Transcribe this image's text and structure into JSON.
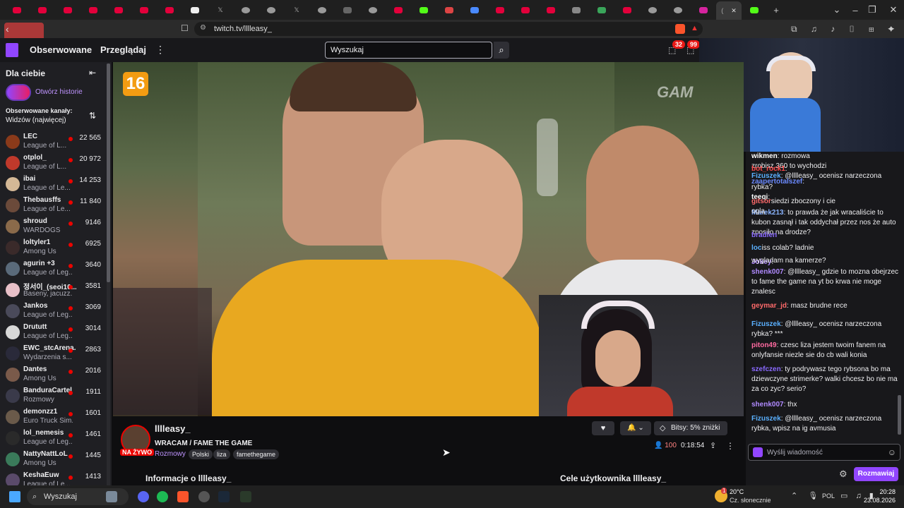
{
  "browser": {
    "url": "twitch.tv/lllleasy_",
    "tab_active_label": "(",
    "badge_extension": "99"
  },
  "topnav": {
    "following": "Obserwowane",
    "browse": "Przeglądaj",
    "search_placeholder": "Wyszukaj",
    "notif_count": "32",
    "inbox_count": "99"
  },
  "sidebar": {
    "title": "Dla ciebie",
    "stories": "Otwórz historie",
    "followed_label": "Obserwowane kanały:",
    "sort_label": "Widzów (najwięcej)",
    "channels": [
      {
        "name": "LEC",
        "game": "League of L...",
        "viewers": "22 565",
        "color": "#8a3a1a"
      },
      {
        "name": "otplol_",
        "game": "League of L...",
        "viewers": "20 972",
        "color": "#c0392b"
      },
      {
        "name": "ibai",
        "game": "League of Le...",
        "viewers": "14 253",
        "color": "#d4b896"
      },
      {
        "name": "Thebausffs",
        "game": "League of Le...",
        "viewers": "11 840",
        "color": "#6b4a3a"
      },
      {
        "name": "shroud",
        "game": "WARDOGS",
        "viewers": "9146",
        "color": "#8a6a4a"
      },
      {
        "name": "loltyler1",
        "game": "Among Us",
        "viewers": "6925",
        "color": "#3a2a2a"
      },
      {
        "name": "agurin +3",
        "game": "League of Leg...",
        "viewers": "3640",
        "color": "#5a6a7a"
      },
      {
        "name": "정서이_(seoi10...",
        "game": "Baseny, jacuzz...",
        "viewers": "3581",
        "color": "#e8c0c8"
      },
      {
        "name": "Jankos",
        "game": "League of Leg...",
        "viewers": "3069",
        "color": "#4a4a5a"
      },
      {
        "name": "Drututt",
        "game": "League of Leg...",
        "viewers": "3014",
        "color": "#d8d8d8"
      },
      {
        "name": "EWC_stcArena...",
        "game": "Wydarzenia s...",
        "viewers": "2863",
        "color": "#2a2a3a"
      },
      {
        "name": "Dantes",
        "game": "Among Us",
        "viewers": "2016",
        "color": "#7a5a4a"
      },
      {
        "name": "BanduraCartel",
        "game": "Rozmowy",
        "viewers": "1911",
        "color": "#3a3a4a"
      },
      {
        "name": "demonzz1",
        "game": "Euro Truck Sim...",
        "viewers": "1601",
        "color": "#6a5a4a"
      },
      {
        "name": "lol_nemesis",
        "game": "League of Leg...",
        "viewers": "1461",
        "color": "#2a2a2a"
      },
      {
        "name": "NattyNattLoL",
        "game": "Among Us",
        "viewers": "1445",
        "color": "#3a7a5a"
      },
      {
        "name": "KeshaEuw",
        "game": "League of Le...",
        "viewers": "1413",
        "color": "#5a4a6a"
      }
    ]
  },
  "video": {
    "age_rating": "16",
    "watermark": "GAM"
  },
  "chat": {
    "messages": [
      {
        "user": "wikmen",
        "text": ": rozmowa",
        "color": "#ffffff"
      },
      {
        "user": "",
        "text": "zrobisz 360 to wychodzi",
        "color": "#efeff1"
      },
      {
        "user": "bot_rock1",
        "text": ":",
        "color": "#ff4a4a"
      },
      {
        "user": "Fizuszek",
        "text": ": @lllleasy_ ocenisz narzeczona",
        "color": "#5ab0ff"
      },
      {
        "user": "zaapertotalszef",
        "text": ":",
        "color": "#6b8aff"
      },
      {
        "user": "",
        "text": "rybka?",
        "color": "#efeff1"
      },
      {
        "user": "teeqi",
        "text": ":",
        "color": "#ffffff"
      },
      {
        "user": "gitsor",
        "text": "siedzi zboczony i cie",
        "color": "#ff6a6a"
      },
      {
        "user": "Marek213",
        "text": ": to prawda że jak wracaliście to kubon zasnął i tak oddychał przez nos że auto znosiło na drodze?",
        "color": "#8ab4ff"
      },
      {
        "user": "bradien",
        "text": "",
        "color": "#8a6aff"
      },
      {
        "user": "",
        "text": "oglą",
        "color": "#efeff1"
      },
      {
        "user": "loc",
        "text": "iss colab? ladnie",
        "color": "#5ab0ff"
      },
      {
        "user": "Jokey",
        "text": ":",
        "color": "#b08aff"
      },
      {
        "user": "",
        "text": "wygladam na kamerze?",
        "color": "#efeff1"
      },
      {
        "user": "shenk007",
        "text": ": @lllleasy_ gdzie to mozna obejrzec to fame the game na yt bo krwa nie moge znalesc",
        "color": "#b08aff"
      },
      {
        "user": "geymar_jd",
        "text": ": masz brudne rece",
        "color": "#ff6a6a"
      },
      {
        "user": "Fizuszek",
        "text": ": @lllleasy_ ocenisz narzeczona rybka? ***",
        "color": "#5ab0ff"
      },
      {
        "user": "piton49",
        "text": ": czesc liza jestem twoim fanem na onlyfansie niezle sie do cb wali konia",
        "color": "#ff6aa0"
      },
      {
        "user": "szefczen",
        "text": ": ty podrywasz tego rybsona bo ma dziewczyne strimerke? walki chcesz bo nie ma za co zyc? serio?",
        "color": "#8a6aff"
      },
      {
        "user": "shenk007",
        "text": ": thx",
        "color": "#b08aff"
      },
      {
        "user": "Fizuszek",
        "text": ": @lllleasy_ ocenisz narzeczona rybka, wpisz na ig avmusia",
        "color": "#5ab0ff"
      }
    ],
    "input_placeholder": "Wyślij wiadomość",
    "send_label": "Rozmawiaj"
  },
  "stream": {
    "streamer": "lllleasy_",
    "title": "WRACAM / FAME THE GAME",
    "live_label": "NA ŻYWO",
    "category": "Rozmowy",
    "tags": [
      "Polski",
      "liza",
      "famethegame"
    ],
    "viewers": "100",
    "uptime": "0:18:54",
    "bits": "Bitsy: 5% zniżki",
    "about": "Informacje o lllleasy_",
    "goals": "Cele użytkownika lllleasy_"
  },
  "taskbar": {
    "search": "Wyszukaj",
    "weather": "20°C",
    "weather_desc": "Cz. słonecznie",
    "lang": "POL",
    "time": "20:28",
    "date": "23.08.2026",
    "notif": "1"
  }
}
